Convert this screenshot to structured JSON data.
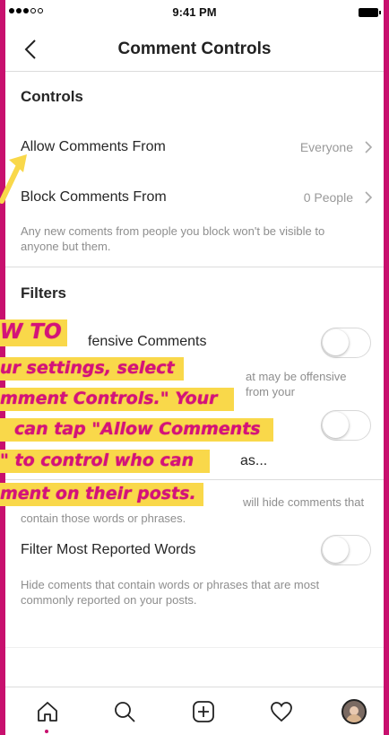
{
  "status": {
    "time": "9:41 PM"
  },
  "nav": {
    "title": "Comment Controls"
  },
  "controls": {
    "header": "Controls",
    "allow": {
      "label": "Allow Comments From",
      "value": "Everyone"
    },
    "block": {
      "label": "Block Comments From",
      "value": "0 People"
    },
    "block_desc": "Any new coments from people you block won't be visible to anyone but them."
  },
  "filters": {
    "header": "Filters",
    "offensive": {
      "label_partial": "fensive Comments",
      "desc_partial": "at may be offensive from your"
    },
    "manual": {
      "label_partial": "as...",
      "desc_partial": "will hide comments that",
      "desc_line2": "contain those words or phrases."
    },
    "reported": {
      "label": "Filter Most Reported Words",
      "desc": "Hide coments that contain words or phrases that are most commonly reported on your posts."
    }
  },
  "overlay": {
    "lines": [
      "W TO",
      "ur settings, select",
      "mment Controls.\" Your",
      "can tap \"Allow Comments",
      "\" to control who can",
      "ment on their posts."
    ]
  },
  "colors": {
    "brand": "#c8106e",
    "highlight": "#f9d84a",
    "text": "#262626",
    "muted": "#8e8e8e"
  },
  "tabbar": {
    "items": [
      "home-icon",
      "search-icon",
      "add-post-icon",
      "heart-icon",
      "profile-avatar"
    ]
  }
}
